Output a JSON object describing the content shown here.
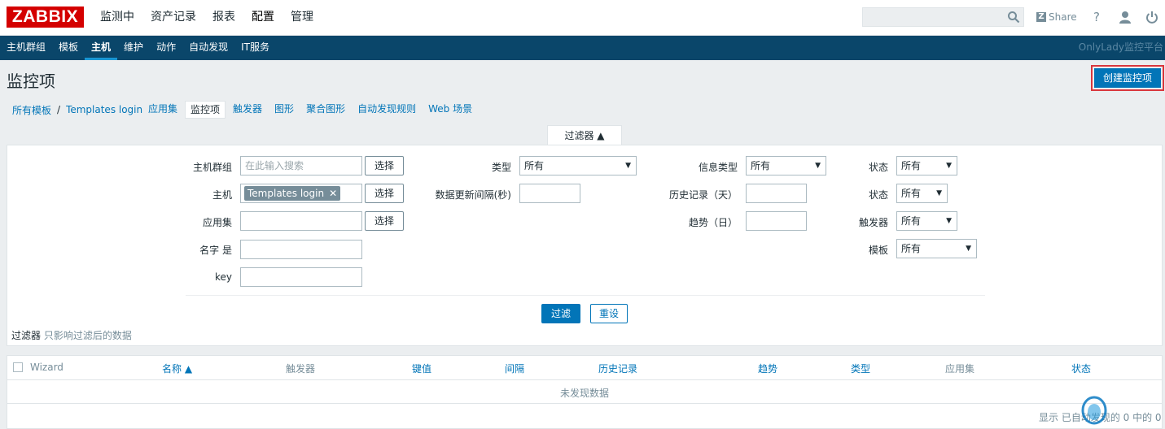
{
  "header": {
    "logo": "ZABBIX",
    "menu": [
      "监测中",
      "资产记录",
      "报表",
      "配置",
      "管理"
    ],
    "active_menu": "配置",
    "share_label": "Share",
    "help_glyph": "?"
  },
  "submenu": {
    "items": [
      "主机群组",
      "模板",
      "主机",
      "维护",
      "动作",
      "自动发现",
      "IT服务"
    ],
    "active": "主机",
    "brand": "OnlyLady监控平台"
  },
  "page": {
    "title": "监控项",
    "create_button": "创建监控项"
  },
  "breadcrumb": {
    "all_templates": "所有模板",
    "separator": "/",
    "template": "Templates login"
  },
  "tabs": [
    "应用集",
    "监控项",
    "触发器",
    "图形",
    "聚合图形",
    "自动发现规则",
    "Web 场景"
  ],
  "active_tab": "监控项",
  "filter": {
    "tab_label": "过滤器 ▲",
    "host_group_label": "主机群组",
    "host_group_placeholder": "在此输入搜索",
    "host_label": "主机",
    "host_chip": "Templates login",
    "app_label": "应用集",
    "name_label": "名字 是",
    "key_label": "key",
    "select_button": "选择",
    "type_label": "类型",
    "type_value": "所有",
    "interval_label": "数据更新间隔(秒)",
    "info_type_label": "信息类型",
    "info_type_value": "所有",
    "history_label": "历史记录（天）",
    "trends_label": "趋势（日）",
    "state_label": "状态",
    "state_value": "所有",
    "status_label": "状态",
    "status_value": "所有",
    "triggers_label": "触发器",
    "triggers_value": "所有",
    "template_label": "模板",
    "template_value": "所有",
    "apply_button": "过滤",
    "reset_button": "重设",
    "note_bold": "过滤器",
    "note_text": " 只影响过滤后的数据"
  },
  "table": {
    "columns": [
      "Wizard",
      "名称 ▲",
      "触发器",
      "键值",
      "间隔",
      "历史记录",
      "趋势",
      "类型",
      "应用集",
      "状态"
    ],
    "empty_text": "未发现数据"
  },
  "footer": {
    "text": "显示 已自动发现的 0 中的 0"
  },
  "colors": {
    "brand_red": "#d40000",
    "nav_dark": "#0a466a",
    "primary_blue": "#0275b8",
    "highlight_red": "#d9373d"
  }
}
